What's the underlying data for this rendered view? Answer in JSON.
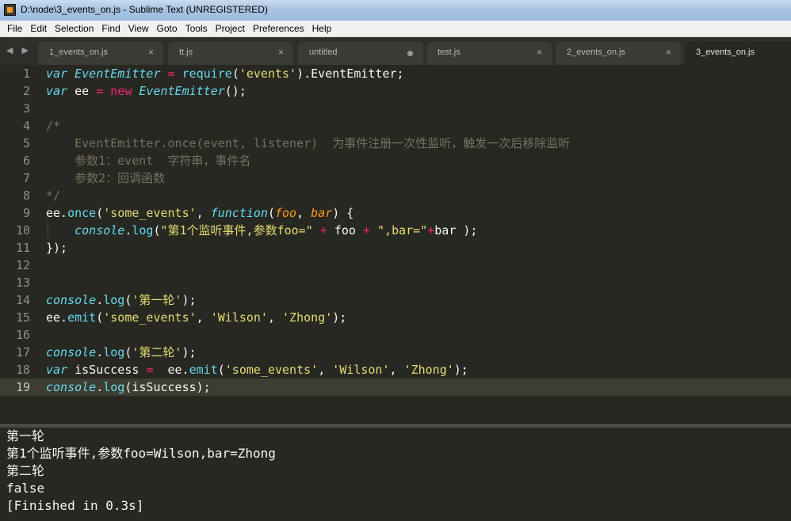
{
  "window": {
    "title": "D:\\node\\3_events_on.js - Sublime Text (UNREGISTERED)"
  },
  "menu": [
    "File",
    "Edit",
    "Selection",
    "Find",
    "View",
    "Goto",
    "Tools",
    "Project",
    "Preferences",
    "Help"
  ],
  "nav": {
    "arrows": "◀ ▶"
  },
  "tabs": [
    {
      "label": "1_events_on.js",
      "state": "close"
    },
    {
      "label": "tt.js",
      "state": "close"
    },
    {
      "label": "untitled",
      "state": "dirty"
    },
    {
      "label": "test.js",
      "state": "close"
    },
    {
      "label": "2_events_on.js",
      "state": "close"
    },
    {
      "label": "3_events_on.js",
      "state": "active"
    }
  ],
  "tab_close_glyph": "×",
  "current_line": 19,
  "code": {
    "l1": {
      "n": "1",
      "t": [
        "var",
        " ",
        "EventEmitter",
        " ",
        "=",
        " ",
        "require",
        "(",
        "'events'",
        ").EventEmitter;"
      ]
    },
    "l2": {
      "n": "2",
      "t": [
        "var",
        " ee ",
        "=",
        " ",
        "new",
        " ",
        "EventEmitter",
        "();"
      ]
    },
    "l3": {
      "n": "3",
      "t": []
    },
    "l4": {
      "n": "4",
      "t": [
        "/*"
      ]
    },
    "l5": {
      "n": "5",
      "t": [
        "    EventEmitter.once(event, listener)  为事件注册一次性监听，触发一次后移除监听"
      ]
    },
    "l6": {
      "n": "6",
      "t": [
        "    参数1：event  字符串，事件名"
      ]
    },
    "l7": {
      "n": "7",
      "t": [
        "    参数2：回调函数"
      ]
    },
    "l8": {
      "n": "8",
      "t": [
        "*/"
      ]
    },
    "l9": {
      "n": "9",
      "t": [
        "ee.",
        "once",
        "(",
        "'some_events'",
        ", ",
        "function",
        "(",
        "foo",
        ", ",
        "bar",
        ") {"
      ]
    },
    "l10": {
      "n": "10",
      "t": [
        "    ",
        "console",
        ".",
        "log",
        "(",
        "\"第1个监听事件,参数foo=\"",
        " ",
        "+",
        " foo ",
        "+",
        " ",
        "\",bar=\"",
        "+",
        "bar );"
      ]
    },
    "l11": {
      "n": "11",
      "t": [
        "});"
      ]
    },
    "l12": {
      "n": "12",
      "t": []
    },
    "l13": {
      "n": "13",
      "t": []
    },
    "l14": {
      "n": "14",
      "t": [
        "console",
        ".",
        "log",
        "(",
        "'第一轮'",
        ");"
      ]
    },
    "l15": {
      "n": "15",
      "t": [
        "ee.",
        "emit",
        "(",
        "'some_events'",
        ", ",
        "'Wilson'",
        ", ",
        "'Zhong'",
        ");"
      ]
    },
    "l16": {
      "n": "16",
      "t": []
    },
    "l17": {
      "n": "17",
      "t": [
        "console",
        ".",
        "log",
        "(",
        "'第二轮'",
        ");"
      ]
    },
    "l18": {
      "n": "18",
      "t": [
        "var",
        " isSuccess ",
        "=",
        "  ee.",
        "emit",
        "(",
        "'some_events'",
        ", ",
        "'Wilson'",
        ", ",
        "'Zhong'",
        ");"
      ]
    },
    "l19": {
      "n": "19",
      "t": [
        "console",
        ".",
        "log",
        "(isSuccess);"
      ]
    }
  },
  "output": [
    "第一轮",
    "第1个监听事件,参数foo=Wilson,bar=Zhong",
    "第二轮",
    "false",
    "[Finished in 0.3s]"
  ],
  "colors": {
    "background": "#272822",
    "keyword": "#66d9ef",
    "operator": "#f92672",
    "string": "#e6db74",
    "comment": "#75715e",
    "parameter": "#fd971f"
  }
}
